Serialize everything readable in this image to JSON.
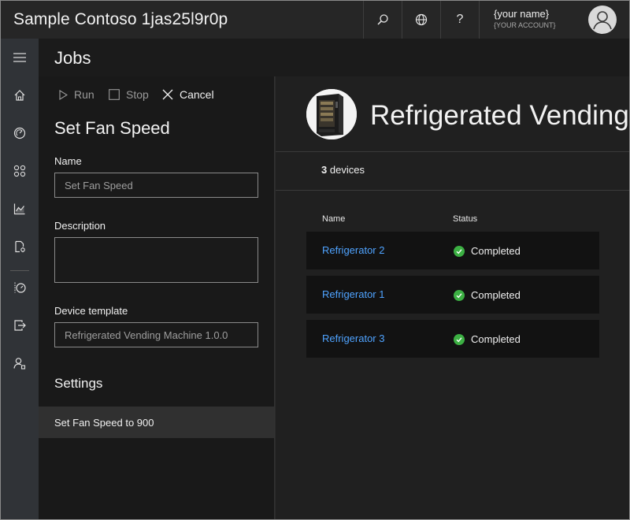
{
  "header": {
    "app_title": "Sample Contoso 1jas25l9r0p",
    "search_icon": "search-icon",
    "globe_icon": "globe-icon",
    "help_label": "?",
    "account_name": "{your name}",
    "account_sub": "{YOUR ACCOUNT}"
  },
  "nav": {
    "items": [
      "menu-icon",
      "home-icon",
      "dashboard-icon",
      "devices-icon",
      "analytics-icon",
      "device-templates-icon",
      "jobs-icon",
      "data-export-icon",
      "administration-icon"
    ]
  },
  "page": {
    "title": "Jobs"
  },
  "job": {
    "commands": {
      "run": "Run",
      "stop": "Stop",
      "cancel": "Cancel"
    },
    "name_heading": "Set Fan Speed",
    "name_label": "Name",
    "name_value": "Set Fan Speed",
    "description_label": "Description",
    "description_value": "",
    "template_label": "Device template",
    "template_value": "Refrigerated Vending Machine 1.0.0",
    "settings_heading": "Settings",
    "setting_item": "Set Fan Speed to 900"
  },
  "template_panel": {
    "title": "Refrigerated Vending Machine",
    "count": "3",
    "count_suffix": "devices",
    "columns": {
      "name": "Name",
      "status": "Status"
    },
    "devices": [
      {
        "name": "Refrigerator 2",
        "status": "Completed"
      },
      {
        "name": "Refrigerator 1",
        "status": "Completed"
      },
      {
        "name": "Refrigerator 3",
        "status": "Completed"
      }
    ]
  },
  "colors": {
    "link": "#4fa3ff",
    "success": "#3cb043",
    "topbar": "#262626",
    "rail": "#303337"
  }
}
